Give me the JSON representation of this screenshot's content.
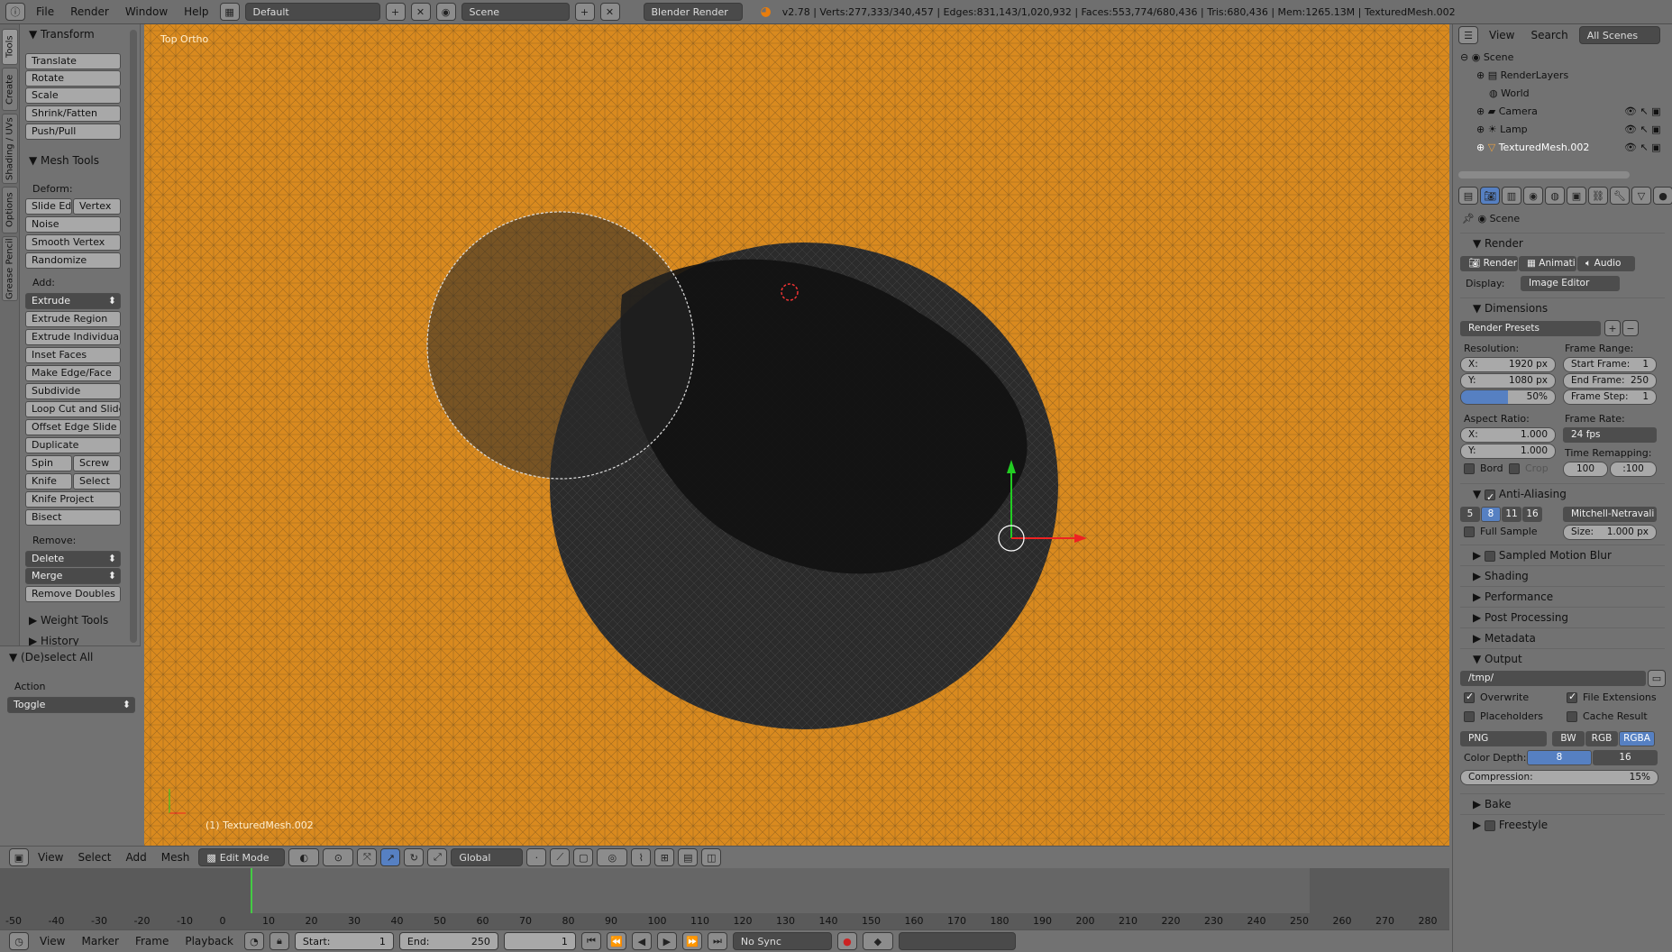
{
  "topbar": {
    "menus": [
      "File",
      "Render",
      "Window",
      "Help"
    ],
    "layout": "Default",
    "scene": "Scene",
    "engine": "Blender Render",
    "stats": "v2.78 | Verts:277,333/340,457 | Edges:831,143/1,020,932 | Faces:553,774/680,436 | Tris:680,436 | Mem:1265.13M | TexturedMesh.002"
  },
  "shelf": {
    "tabs": [
      "Tools",
      "Create",
      "Shading / UVs",
      "Options",
      "Grease Pencil"
    ],
    "transform_title": "Transform",
    "transform": [
      "Translate",
      "Rotate",
      "Scale",
      "Shrink/Fatten",
      "Push/Pull"
    ],
    "meshtools_title": "Mesh Tools",
    "deform_label": "Deform:",
    "slide_edge": "Slide Ed",
    "vertex": "Vertex",
    "deform": [
      "Noise",
      "Smooth Vertex",
      "Randomize"
    ],
    "add_label": "Add:",
    "extrude": "Extrude",
    "add": [
      "Extrude Region",
      "Extrude Individual",
      "Inset Faces",
      "Make Edge/Face",
      "Subdivide",
      "Loop Cut and Slide",
      "Offset Edge Slide",
      "Duplicate"
    ],
    "spin": "Spin",
    "screw": "Screw",
    "knife": "Knife",
    "select": "Select",
    "knife_project": "Knife Project",
    "bisect": "Bisect",
    "remove_label": "Remove:",
    "delete": "Delete",
    "merge": "Merge",
    "remove_doubles": "Remove Doubles",
    "weight_tools": "Weight Tools",
    "history": "History",
    "operator_title": "(De)select All",
    "action_label": "Action",
    "action_value": "Toggle"
  },
  "viewport": {
    "view_name": "Top Ortho",
    "object_label": "(1) TexturedMesh.002"
  },
  "vp_header": {
    "menus": [
      "View",
      "Select",
      "Add",
      "Mesh"
    ],
    "mode": "Edit Mode",
    "orientation": "Global"
  },
  "timeline": {
    "ticks": [
      "-50",
      "-40",
      "-30",
      "-20",
      "-10",
      "0",
      "10",
      "20",
      "30",
      "40",
      "50",
      "60",
      "70",
      "80",
      "90",
      "100",
      "110",
      "120",
      "130",
      "140",
      "150",
      "160",
      "170",
      "180",
      "190",
      "200",
      "210",
      "220",
      "230",
      "240",
      "250",
      "260",
      "270",
      "280"
    ],
    "menus": [
      "View",
      "Marker",
      "Frame",
      "Playback"
    ],
    "start_label": "Start:",
    "start": "1",
    "end_label": "End:",
    "end": "250",
    "current": "1",
    "sync": "No Sync"
  },
  "outliner": {
    "menus": [
      "View",
      "Search"
    ],
    "scope": "All Scenes",
    "items": [
      "Scene",
      "RenderLayers",
      "World",
      "Camera",
      "Lamp",
      "TexturedMesh.002"
    ]
  },
  "props": {
    "scene_label": "Scene",
    "render_title": "Render",
    "render_btn": "Render",
    "animation_btn": "Animation",
    "audio_btn": "Audio",
    "display_label": "Display:",
    "display_value": "Image Editor",
    "dimensions_title": "Dimensions",
    "presets": "Render Presets",
    "resolution_label": "Resolution:",
    "res_x": "X:",
    "res_x_val": "1920 px",
    "res_y": "Y:",
    "res_y_val": "1080 px",
    "res_pct": "50%",
    "frame_range_label": "Frame Range:",
    "start_frame": "Start Frame:",
    "start_frame_val": "1",
    "end_frame": "End Frame:",
    "end_frame_val": "250",
    "frame_step": "Frame Step:",
    "frame_step_val": "1",
    "aspect_label": "Aspect Ratio:",
    "asp_x": "X:",
    "asp_x_val": "1.000",
    "asp_y": "Y:",
    "asp_y_val": "1.000",
    "frame_rate_label": "Frame Rate:",
    "fps": "24 fps",
    "time_remap_label": "Time Remapping:",
    "remap_old": "100",
    "remap_new": ":100",
    "bord": "Bord",
    "crop": "Crop",
    "aa_title": "Anti-Aliasing",
    "aa_samples": [
      "5",
      "8",
      "11",
      "16"
    ],
    "aa_filter": "Mitchell-Netravali",
    "full_sample": "Full Sample",
    "size_label": "Size:",
    "size_val": "1.000 px",
    "motion_blur": "Sampled Motion Blur",
    "shading": "Shading",
    "performance": "Performance",
    "post": "Post Processing",
    "metadata": "Metadata",
    "output_title": "Output",
    "output_path": "/tmp/",
    "overwrite": "Overwrite",
    "file_ext": "File Extensions",
    "placeholders": "Placeholders",
    "cache": "Cache Result",
    "format": "PNG",
    "bw": "BW",
    "rgb": "RGB",
    "rgba": "RGBA",
    "depth_label": "Color Depth:",
    "depth8": "8",
    "depth16": "16",
    "compression_label": "Compression:",
    "compression_val": "15%",
    "bake": "Bake",
    "freestyle": "Freestyle"
  },
  "colors": {
    "selected_mesh": "#d98a1f",
    "accent": "#5680c2"
  }
}
